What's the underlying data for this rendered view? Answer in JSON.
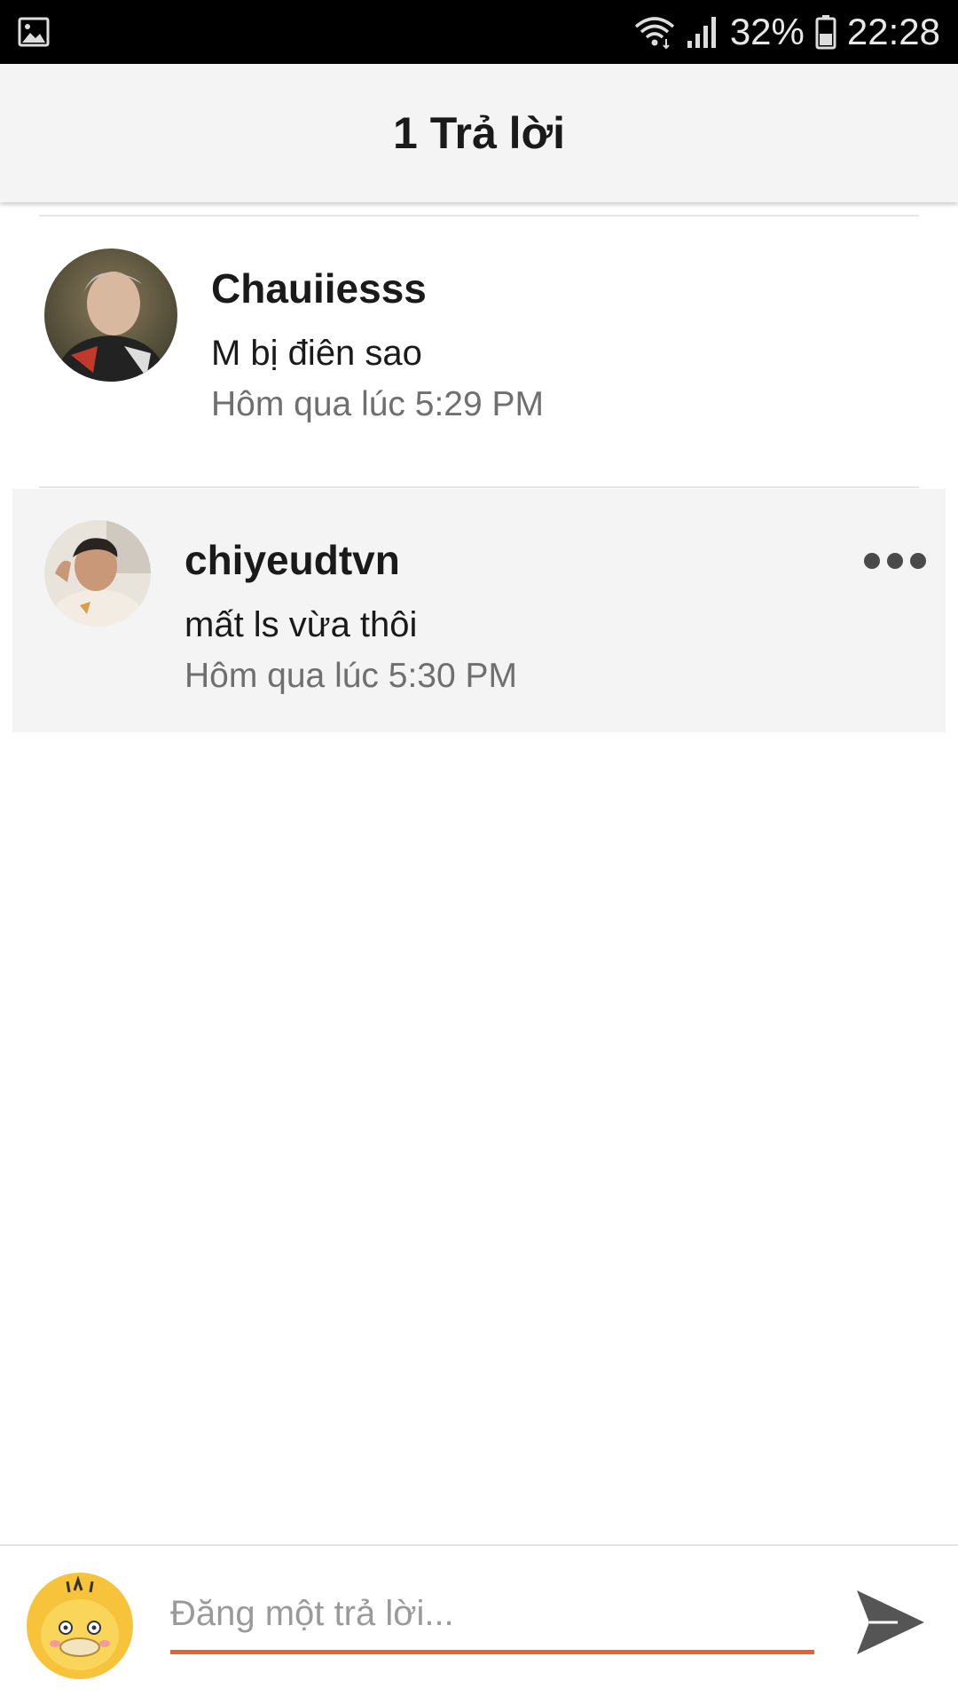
{
  "status_bar": {
    "battery": "32%",
    "time": "22:28",
    "icons": [
      "gallery-icon",
      "wifi-icon",
      "signal-icon",
      "battery-icon"
    ]
  },
  "header": {
    "title": "1 Trả lời"
  },
  "comments": [
    {
      "username": "Chauiiesss",
      "message": "M bị điên sao",
      "time": "Hôm qua lúc 5:29 PM"
    },
    {
      "username": "chiyeudtvn",
      "message": "mất ls vừa thôi",
      "time": "Hôm qua lúc 5:30 PM"
    }
  ],
  "composer": {
    "placeholder": "Đăng một trả lời...",
    "value": ""
  },
  "colors": {
    "accent": "#e8602c",
    "reply_bg": "#f4f4f4",
    "header_bg": "#f4f4f4",
    "time_text": "#6f6f6f"
  }
}
